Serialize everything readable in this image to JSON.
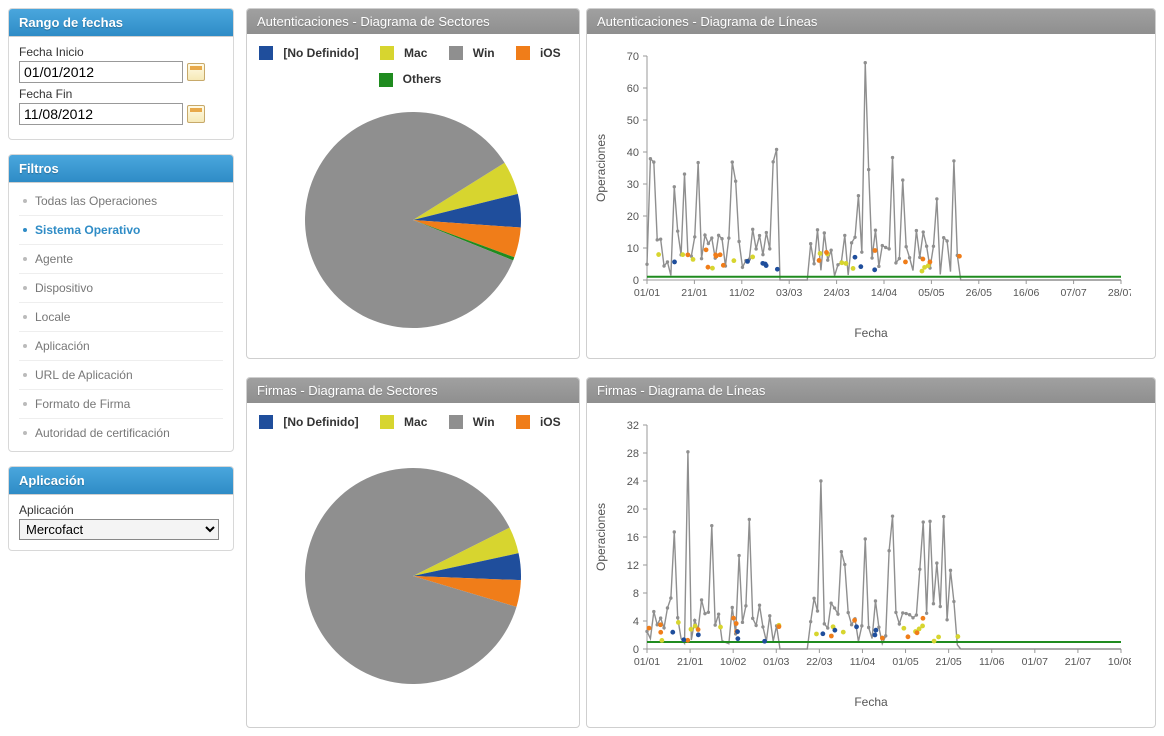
{
  "colors": {
    "no_definido": "#1f4e9c",
    "mac": "#d7d52f",
    "win": "#8f8f8f",
    "ios": "#f07d19",
    "others": "#1f8b1f",
    "axis": "#999",
    "grid": "#ddd"
  },
  "sidebar": {
    "date_range": {
      "title": "Rango de fechas",
      "start_label": "Fecha Inicio",
      "start_value": "01/01/2012",
      "end_label": "Fecha Fin",
      "end_value": "11/08/2012"
    },
    "filters": {
      "title": "Filtros",
      "items": [
        {
          "label": "Todas las Operaciones",
          "active": false
        },
        {
          "label": "Sistema Operativo",
          "active": true
        },
        {
          "label": "Agente",
          "active": false
        },
        {
          "label": "Dispositivo",
          "active": false
        },
        {
          "label": "Locale",
          "active": false
        },
        {
          "label": "Aplicación",
          "active": false
        },
        {
          "label": "URL de Aplicación",
          "active": false
        },
        {
          "label": "Formato de Firma",
          "active": false
        },
        {
          "label": "Autoridad de certificación",
          "active": false
        }
      ]
    },
    "app": {
      "title": "Aplicación",
      "label": "Aplicación",
      "selected": "Mercofact"
    }
  },
  "charts": {
    "auth_pie": {
      "title": "Autenticaciones - Diagrama de Sectores",
      "legend": [
        "[No Definido]",
        "Mac",
        "Win",
        "iOS",
        "Others"
      ]
    },
    "auth_line": {
      "title": "Autenticaciones - Diagrama de Líneas",
      "ylabel": "Operaciones",
      "xlabel": "Fecha",
      "xticks": [
        "01/01",
        "21/01",
        "11/02",
        "03/03",
        "24/03",
        "14/04",
        "05/05",
        "26/05",
        "16/06",
        "07/07",
        "28/07"
      ]
    },
    "sign_pie": {
      "title": "Firmas - Diagrama de Sectores",
      "legend": [
        "[No Definido]",
        "Mac",
        "Win",
        "iOS"
      ]
    },
    "sign_line": {
      "title": "Firmas - Diagrama de Líneas",
      "ylabel": "Operaciones",
      "xlabel": "Fecha",
      "xticks": [
        "01/01",
        "21/01",
        "10/02",
        "01/03",
        "22/03",
        "11/04",
        "01/05",
        "21/05",
        "11/06",
        "01/07",
        "21/07",
        "10/08"
      ]
    }
  },
  "chart_data": [
    {
      "type": "pie",
      "title": "Autenticaciones - Diagrama de Sectores",
      "series": [
        {
          "name": "[No Definido]",
          "value": 5
        },
        {
          "name": "Mac",
          "value": 5
        },
        {
          "name": "Win",
          "value": 85
        },
        {
          "name": "iOS",
          "value": 4.5
        },
        {
          "name": "Others",
          "value": 0.5
        }
      ]
    },
    {
      "type": "line",
      "title": "Autenticaciones - Diagrama de Líneas",
      "xlabel": "Fecha",
      "ylabel": "Operaciones",
      "ylim": [
        0,
        70
      ],
      "categories": [
        "01/01",
        "21/01",
        "11/02",
        "03/03",
        "24/03",
        "14/04",
        "05/05",
        "26/05",
        "16/06",
        "07/07",
        "28/07"
      ],
      "series": [
        {
          "name": "Win",
          "values_approx": "dense daily peaks 5–30 with one spike ≈68 near 14/04; gap around early March; trailing zeros from ~26/05 onward"
        },
        {
          "name": "Mac",
          "values_approx": "sparse 2–6 scattered Jan–May"
        },
        {
          "name": "iOS",
          "values_approx": "sparse 2–8 scattered Jan–May"
        },
        {
          "name": "[No Definido]",
          "values_approx": "sparse 2–5 scattered"
        },
        {
          "name": "Others",
          "values_approx": "flat ≈1 baseline across whole range"
        }
      ]
    },
    {
      "type": "pie",
      "title": "Firmas - Diagrama de Sectores",
      "series": [
        {
          "name": "[No Definido]",
          "value": 4
        },
        {
          "name": "Mac",
          "value": 4
        },
        {
          "name": "Win",
          "value": 88
        },
        {
          "name": "iOS",
          "value": 4
        }
      ]
    },
    {
      "type": "line",
      "title": "Firmas - Diagrama de Líneas",
      "xlabel": "Fecha",
      "ylabel": "Operaciones",
      "ylim": [
        0,
        32
      ],
      "categories": [
        "01/01",
        "21/01",
        "10/02",
        "01/03",
        "22/03",
        "11/04",
        "01/05",
        "21/05",
        "11/06",
        "01/07",
        "21/07",
        "10/08"
      ],
      "series": [
        {
          "name": "Win",
          "values_approx": "daily peaks 4–18, max ≈28 near 21/01 and ≈24 near 22/03; gap late Feb; trailing zeros from ~21/05 onward"
        },
        {
          "name": "Mac",
          "values_approx": "sparse 1–3 scattered Jan–May"
        },
        {
          "name": "iOS",
          "values_approx": "sparse 1–4 scattered Jan–May"
        },
        {
          "name": "[No Definido]",
          "values_approx": "sparse 1–4 scattered"
        }
      ]
    }
  ]
}
